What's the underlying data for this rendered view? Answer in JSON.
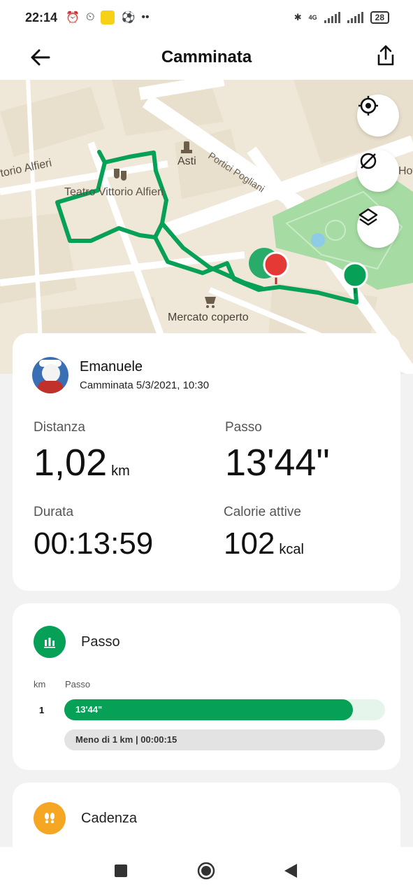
{
  "status_bar": {
    "time": "22:14",
    "dots": "••",
    "network": "4G",
    "battery": "28",
    "icons": [
      "alarm-icon",
      "alarm-snooze-icon",
      "yellow-app-icon",
      "football-icon",
      "bluetooth-icon",
      "signal-icon",
      "signal-2-icon",
      "battery-icon"
    ]
  },
  "header": {
    "title": "Camminata",
    "back_icon": "back-arrow-icon",
    "share_icon": "share-icon"
  },
  "map": {
    "labels": {
      "street_left": "torio Alfieri",
      "landmark_city": "Asti",
      "street_portici": "Portici Pogliani",
      "theatre": "Teatro Vittorio Alfieri",
      "market": "Mercato coperto",
      "hotel": "Hot"
    },
    "buttons": [
      "locate-icon",
      "hide-route-icon",
      "layers-icon"
    ],
    "route_color": "#06a057",
    "start_pin_color": "#06a057",
    "end_pin_color": "#e53935"
  },
  "summary": {
    "user_name": "Emanuele",
    "activity_line": "Camminata 5/3/2021, 10:30",
    "metrics": {
      "distance_label": "Distanza",
      "distance_value": "1,02",
      "distance_unit": "km",
      "pace_label": "Passo",
      "pace_value": "13'44\"",
      "duration_label": "Durata",
      "duration_value": "00:13:59",
      "calories_label": "Calorie attive",
      "calories_value": "102",
      "calories_unit": "kcal"
    }
  },
  "pace_section": {
    "title": "Passo",
    "icon": "bar-chart-icon",
    "col_km": "km",
    "col_pace": "Passo",
    "rows": [
      {
        "km": "1",
        "pace": "13'44\"",
        "fraction": 0.9
      }
    ],
    "summary": "Meno di 1 km | 00:00:15",
    "accent": "#06a057"
  },
  "cadence_section": {
    "title": "Cadenza",
    "icon": "footsteps-icon",
    "accent": "#f5a623"
  },
  "nav_bar": {
    "icons": [
      "recent-apps-icon",
      "home-icon",
      "back-triangle-icon"
    ]
  }
}
